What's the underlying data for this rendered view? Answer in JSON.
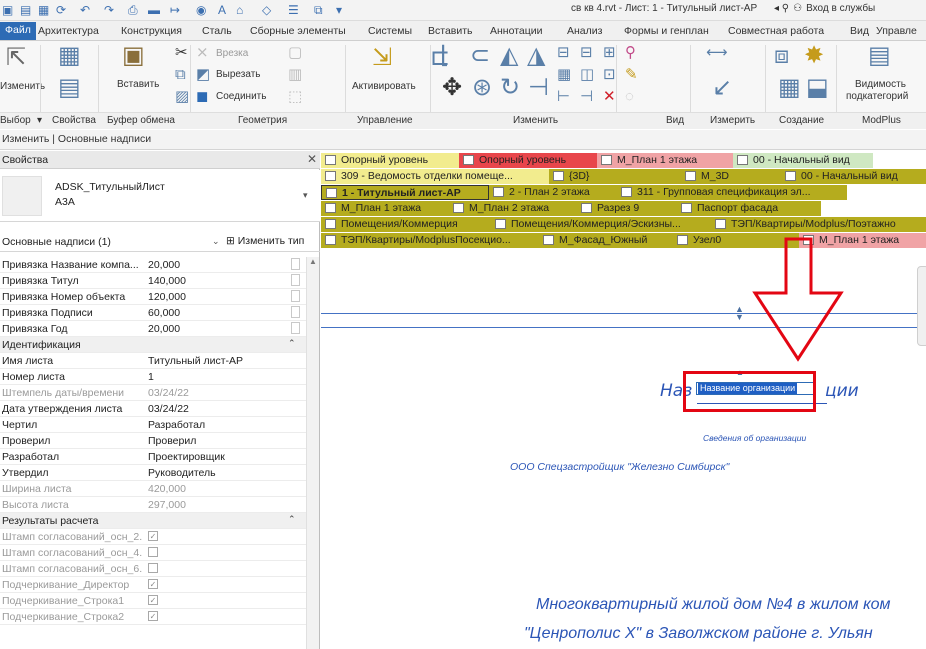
{
  "titlebar": {
    "title": "св кв 4.rvt - Лист: 1 - Титульный лист-АР",
    "signin": "Вход в службы"
  },
  "tabs": [
    "Файл",
    "Архитектура",
    "Конструкция",
    "Сталь",
    "Сборные элементы",
    "Системы",
    "Вставить",
    "Аннотации",
    "Анализ",
    "Формы и генплан",
    "Совместная работа",
    "Вид",
    "Управле"
  ],
  "ribbon": {
    "modify": "Изменить",
    "paste": "Вставить",
    "cope": "Врезка",
    "cut": "Вырезать",
    "join": "Соединить",
    "activate": "Активировать",
    "visibility_line1": "Видимость",
    "visibility_line2": "подкатегорий",
    "groups": {
      "select": "Выбор",
      "properties": "Свойства",
      "clipboard": "Буфер обмена",
      "geometry": "Геометрия",
      "control": "Управление",
      "modify": "Изменить",
      "view": "Вид",
      "measure": "Измерить",
      "create": "Создание",
      "modplus": "ModPlus"
    }
  },
  "contextbar": {
    "label": "Изменить | Основные надписи"
  },
  "properties": {
    "header": "Свойства",
    "type_line1": "ADSK_ТитульныйЛист",
    "type_line2": "А3А",
    "instance_filter": "Основные надписи (1)",
    "edit_type": "Изменить тип",
    "rows": [
      {
        "kind": "param",
        "name": "Привязка Название компа...",
        "value": "20,000",
        "disabled": false
      },
      {
        "kind": "param",
        "name": "Привязка Титул",
        "value": "140,000",
        "disabled": false
      },
      {
        "kind": "param",
        "name": "Привязка Номер объекта",
        "value": "120,000",
        "disabled": false
      },
      {
        "kind": "param",
        "name": "Привязка Подписи",
        "value": "60,000",
        "disabled": false
      },
      {
        "kind": "param",
        "name": "Привязка Год",
        "value": "20,000",
        "disabled": false
      },
      {
        "kind": "section",
        "name": "Идентификация"
      },
      {
        "kind": "param",
        "name": "Имя листа",
        "value": "Титульный лист-АР",
        "disabled": false
      },
      {
        "kind": "param",
        "name": "Номер листа",
        "value": "1",
        "disabled": false
      },
      {
        "kind": "param",
        "name": "Штемпель даты/времени",
        "value": "03/24/22",
        "disabled": true
      },
      {
        "kind": "param",
        "name": "Дата утверждения листа",
        "value": "03/24/22",
        "disabled": false
      },
      {
        "kind": "param",
        "name": "Чертил",
        "value": "Разработал",
        "disabled": false
      },
      {
        "kind": "param",
        "name": "Проверил",
        "value": "Проверил",
        "disabled": false
      },
      {
        "kind": "param",
        "name": "Разработал",
        "value": "Проектировщик",
        "disabled": false
      },
      {
        "kind": "param",
        "name": "Утвердил",
        "value": "Руководитель",
        "disabled": false
      },
      {
        "kind": "param",
        "name": "Ширина листа",
        "value": "420,000",
        "disabled": true
      },
      {
        "kind": "param",
        "name": "Высота листа",
        "value": "297,000",
        "disabled": true
      },
      {
        "kind": "section",
        "name": "Результаты расчета"
      },
      {
        "kind": "check",
        "name": "Штамп согласований_осн_2...",
        "checked": true
      },
      {
        "kind": "check",
        "name": "Штамп согласований_осн_4...",
        "checked": false
      },
      {
        "kind": "check",
        "name": "Штамп согласований_осн_6...",
        "checked": false
      },
      {
        "kind": "check",
        "name": "Подчеркивание_Директор",
        "checked": true
      },
      {
        "kind": "check",
        "name": "Подчеркивание_Строка1",
        "checked": true
      },
      {
        "kind": "check",
        "name": "Подчеркивание_Строка2",
        "checked": true
      }
    ]
  },
  "view_tabs": [
    {
      "label": "Опорный уровень",
      "color": "yellow"
    },
    {
      "label": "Опорный уровень",
      "color": "red"
    },
    {
      "label": "М_План 1 этажа",
      "color": "pink"
    },
    {
      "label": "00 - Начальный вид",
      "color": "green"
    },
    {
      "label": "309 - Ведомость отделки помеще...",
      "color": "yellow"
    },
    {
      "label": "{3D}",
      "color": "olive"
    },
    {
      "label": "М_3D",
      "color": "olive"
    },
    {
      "label": "00 - Начальный вид",
      "color": "olive"
    },
    {
      "label": "1 - Титульный лист-АР",
      "color": "olive",
      "active": true
    },
    {
      "label": "2 - План 2 этажа",
      "color": "olive"
    },
    {
      "label": "311 - Групповая спецификация эл...",
      "color": "olive"
    },
    {
      "label": "М_План 1 этажа",
      "color": "olive"
    },
    {
      "label": "М_План 2 этажа",
      "color": "olive"
    },
    {
      "label": "Разрез 9",
      "color": "olive"
    },
    {
      "label": "Паспорт фасада",
      "color": "olive"
    },
    {
      "label": "Помещения/Коммерция",
      "color": "olive"
    },
    {
      "label": "Помещения/Коммерция/Эскизны...",
      "color": "olive"
    },
    {
      "label": "ТЭП/Квартиры/Modplus/Поэтажно",
      "color": "olive"
    },
    {
      "label": "ТЭП/Квартиры/ModplusПосекцио...",
      "color": "olive"
    },
    {
      "label": "М_Фасад_Южный",
      "color": "olive"
    },
    {
      "label": "Узел0",
      "color": "olive"
    },
    {
      "label": "М_План 1 этажа",
      "color": "pink"
    }
  ],
  "sheet": {
    "org_title_pre": "Наз",
    "org_title_post": "ции",
    "org_edit_value": "Название организации",
    "org_info": "Сведения об организации",
    "company": "ООО Спецзастройщик \"Железно Симбирск\"",
    "project_line1": "Многоквартирный жилой дом №4 в жилом ком",
    "project_line2": "\"Ценрополис Х\" в Заволжском районе г. Ульян"
  },
  "colors": {
    "accent": "#2d6bb5",
    "sheet_text": "#2b55b6",
    "annotation_red": "#e30613",
    "tab_yellow": "#f2ec8e",
    "tab_red": "#e8464b",
    "tab_pink": "#f0a3a5",
    "tab_green": "#cfe8c2",
    "tab_olive": "#b5ac1e"
  }
}
